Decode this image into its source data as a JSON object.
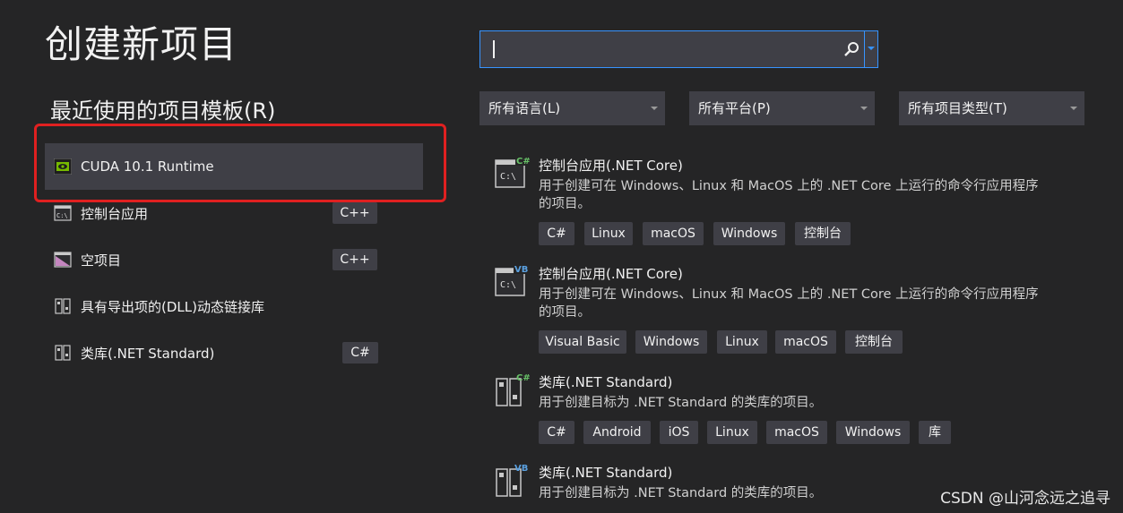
{
  "page_title": "创建新项目",
  "recent": {
    "heading": "最近使用的项目模板(R)",
    "items": [
      {
        "label": "CUDA 10.1 Runtime",
        "lang": "",
        "icon": "nvidia-icon"
      },
      {
        "label": "控制台应用",
        "lang": "C++",
        "icon": "console-app-icon"
      },
      {
        "label": "空项目",
        "lang": "C++",
        "icon": "empty-project-icon"
      },
      {
        "label": "具有导出项的(DLL)动态链接库",
        "lang": "",
        "icon": "dll-library-icon"
      },
      {
        "label": "类库(.NET Standard)",
        "lang": "C#",
        "icon": "class-library-icon"
      }
    ]
  },
  "search": {
    "value": "",
    "placeholder": ""
  },
  "filters": {
    "language": "所有语言(L)",
    "platform": "所有平台(P)",
    "project_type": "所有项目类型(T)"
  },
  "templates": [
    {
      "title": "控制台应用(.NET Core)",
      "desc": "用于创建可在 Windows、Linux 和 MacOS 上的 .NET Core 上运行的命令行应用程序的项目。",
      "badge": "C#",
      "tags": [
        "C#",
        "Linux",
        "macOS",
        "Windows",
        "控制台"
      ]
    },
    {
      "title": "控制台应用(.NET Core)",
      "desc": "用于创建可在 Windows、Linux 和 MacOS 上的 .NET Core 上运行的命令行应用程序的项目。",
      "badge": "VB",
      "tags": [
        "Visual Basic",
        "Windows",
        "Linux",
        "macOS",
        "控制台"
      ]
    },
    {
      "title": "类库(.NET Standard)",
      "desc": "用于创建目标为 .NET Standard 的类库的项目。",
      "badge": "C#",
      "tags": [
        "C#",
        "Android",
        "iOS",
        "Linux",
        "macOS",
        "Windows",
        "库"
      ]
    },
    {
      "title": "类库(.NET Standard)",
      "desc": "用于创建目标为 .NET Standard 的类库的项目。",
      "badge": "VB",
      "tags": []
    }
  ],
  "watermark": "CSDN @山河念远之追寻",
  "colors": {
    "background": "#252526",
    "accent": "#3794ff",
    "highlight": "#e02020",
    "csharp": "#68c268",
    "vb": "#5aa0e0"
  }
}
